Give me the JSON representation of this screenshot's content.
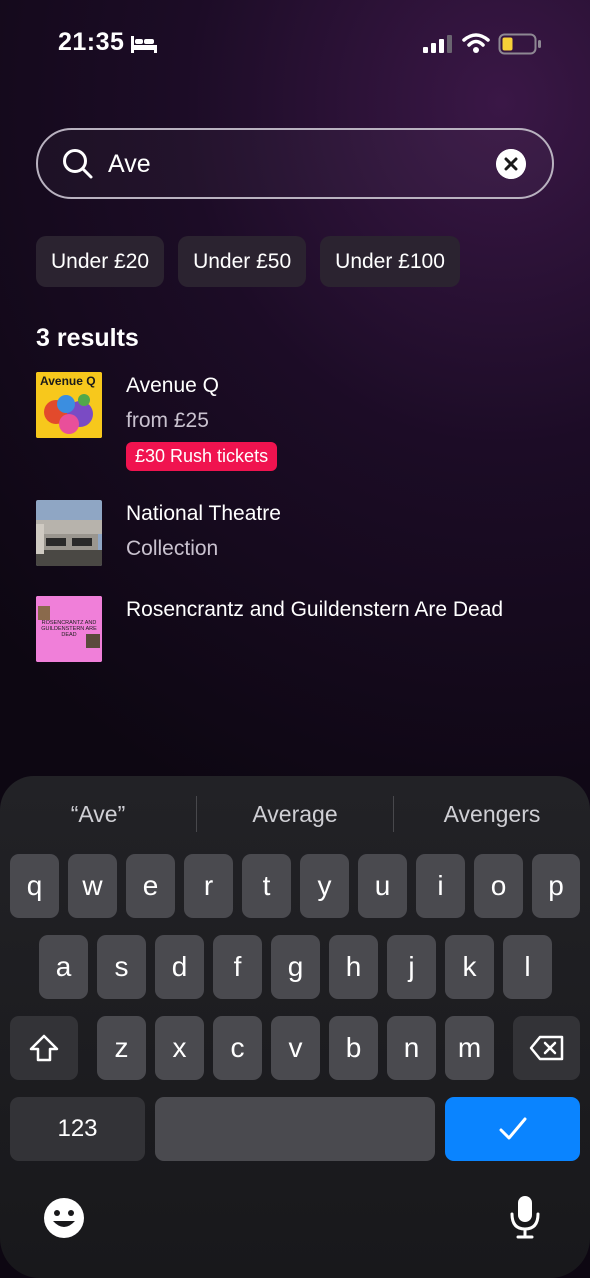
{
  "status_bar": {
    "time": "21:35"
  },
  "search": {
    "value": "Ave",
    "placeholder": "Search"
  },
  "filters": [
    "Under £20",
    "Under £50",
    "Under £100"
  ],
  "results_count": "3 results",
  "results": [
    {
      "title": "Avenue Q",
      "subtitle": "from £25",
      "badge": "£30 Rush tickets",
      "thumb_text": "Avenue Q"
    },
    {
      "title": "National Theatre",
      "subtitle": "Collection"
    },
    {
      "title": "Rosencrantz and Guildenstern Are Dead",
      "thumb_text": "ROSENCRANTZ AND GUILDENSTERN ARE DEAD"
    }
  ],
  "keyboard": {
    "suggestions": [
      "“Ave”",
      "Average",
      "Avengers"
    ],
    "row1": [
      "q",
      "w",
      "e",
      "r",
      "t",
      "y",
      "u",
      "i",
      "o",
      "p"
    ],
    "row2": [
      "a",
      "s",
      "d",
      "f",
      "g",
      "h",
      "j",
      "k",
      "l"
    ],
    "row3": [
      "z",
      "x",
      "c",
      "v",
      "b",
      "n",
      "m"
    ],
    "numbers_label": "123"
  },
  "colors": {
    "accent": "#0a84ff",
    "badge": "#f0134f"
  }
}
